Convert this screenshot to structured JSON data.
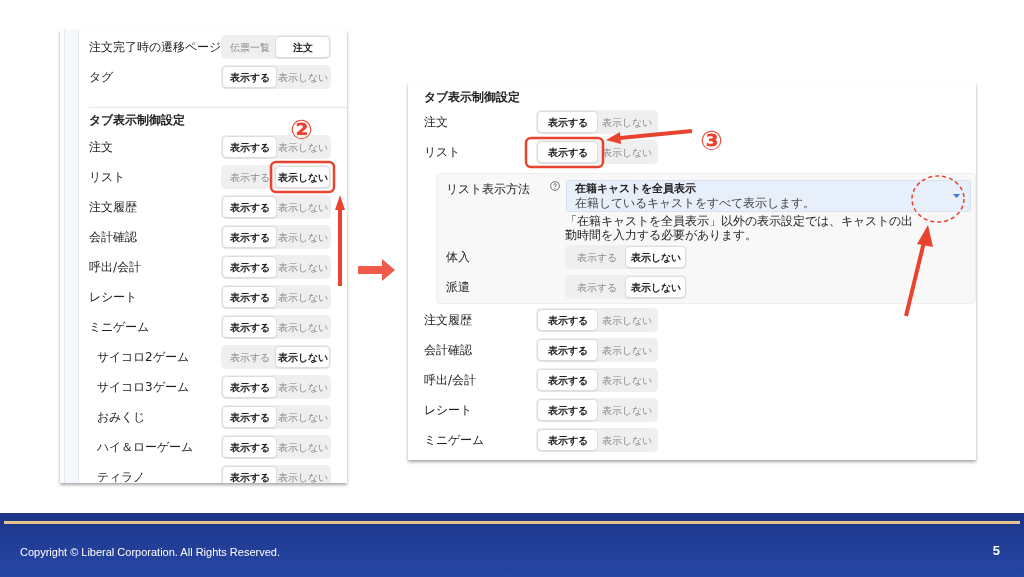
{
  "left_panel": {
    "rows": [
      {
        "kind": "toggle",
        "label": "注文完了時の遷移ページ",
        "options": [
          {
            "label": "伝票一覧",
            "selected": false
          },
          {
            "label": "注文",
            "selected": true
          }
        ]
      },
      {
        "kind": "toggle",
        "label": "タグ",
        "options": [
          {
            "label": "表示する",
            "selected": true
          },
          {
            "label": "表示しない",
            "selected": false
          }
        ]
      },
      {
        "kind": "divider"
      },
      {
        "kind": "heading",
        "label": "タブ表示制御設定"
      },
      {
        "kind": "toggle",
        "label": "注文",
        "options": [
          {
            "label": "表示する",
            "selected": true
          },
          {
            "label": "表示しない",
            "selected": false
          }
        ]
      },
      {
        "kind": "toggle",
        "label": "リスト",
        "options": [
          {
            "label": "表示する",
            "selected": false
          },
          {
            "label": "表示しない",
            "selected": true
          }
        ]
      },
      {
        "kind": "toggle",
        "label": "注文履歴",
        "options": [
          {
            "label": "表示する",
            "selected": true
          },
          {
            "label": "表示しない",
            "selected": false
          }
        ]
      },
      {
        "kind": "toggle",
        "label": "会計確認",
        "options": [
          {
            "label": "表示する",
            "selected": true
          },
          {
            "label": "表示しない",
            "selected": false
          }
        ]
      },
      {
        "kind": "toggle",
        "label": "呼出/会計",
        "options": [
          {
            "label": "表示する",
            "selected": true
          },
          {
            "label": "表示しない",
            "selected": false
          }
        ]
      },
      {
        "kind": "toggle",
        "label": "レシート",
        "options": [
          {
            "label": "表示する",
            "selected": true
          },
          {
            "label": "表示しない",
            "selected": false
          }
        ]
      },
      {
        "kind": "toggle",
        "label": "ミニゲーム",
        "options": [
          {
            "label": "表示する",
            "selected": true
          },
          {
            "label": "表示しない",
            "selected": false
          }
        ],
        "children": [
          {
            "kind": "toggle",
            "label": "サイコロ2ゲーム",
            "options": [
              {
                "label": "表示する",
                "selected": false
              },
              {
                "label": "表示しない",
                "selected": true
              }
            ]
          },
          {
            "kind": "toggle",
            "label": "サイコロ3ゲーム",
            "options": [
              {
                "label": "表示する",
                "selected": true
              },
              {
                "label": "表示しない",
                "selected": false
              }
            ]
          },
          {
            "kind": "toggle",
            "label": "おみくじ",
            "options": [
              {
                "label": "表示する",
                "selected": true
              },
              {
                "label": "表示しない",
                "selected": false
              }
            ]
          },
          {
            "kind": "toggle",
            "label": "ハイ＆ローゲーム",
            "options": [
              {
                "label": "表示する",
                "selected": true
              },
              {
                "label": "表示しない",
                "selected": false
              }
            ]
          },
          {
            "kind": "toggle",
            "label": "ティラノ",
            "options": [
              {
                "label": "表示する",
                "selected": true
              },
              {
                "label": "表示しない",
                "selected": false
              }
            ]
          }
        ]
      }
    ]
  },
  "right_panel": {
    "rows": [
      {
        "kind": "heading",
        "label": "タブ表示制御設定"
      },
      {
        "kind": "toggle",
        "label": "注文",
        "options": [
          {
            "label": "表示する",
            "selected": true
          },
          {
            "label": "表示しない",
            "selected": false
          }
        ]
      },
      {
        "kind": "toggle",
        "label": "リスト",
        "options": [
          {
            "label": "表示する",
            "selected": true
          },
          {
            "label": "表示しない",
            "selected": false
          }
        ]
      },
      {
        "kind": "subpanel",
        "select": {
          "label": "リスト表示方法",
          "value": "在籍キャストを全員表示",
          "description": "在籍しているキャストをすべて表示します。",
          "note": "「在籍キャストを全員表示」以外の表示設定では、キャストの出勤時間を入力する必要があります。"
        },
        "rows": [
          {
            "kind": "toggle",
            "label": "体入",
            "options": [
              {
                "label": "表示する",
                "selected": false
              },
              {
                "label": "表示しない",
                "selected": true
              }
            ]
          },
          {
            "kind": "toggle",
            "label": "派遣",
            "options": [
              {
                "label": "表示する",
                "selected": false
              },
              {
                "label": "表示しない",
                "selected": true
              }
            ]
          }
        ]
      },
      {
        "kind": "toggle",
        "label": "注文履歴",
        "options": [
          {
            "label": "表示する",
            "selected": true
          },
          {
            "label": "表示しない",
            "selected": false
          }
        ]
      },
      {
        "kind": "toggle",
        "label": "会計確認",
        "options": [
          {
            "label": "表示する",
            "selected": true
          },
          {
            "label": "表示しない",
            "selected": false
          }
        ]
      },
      {
        "kind": "toggle",
        "label": "呼出/会計",
        "options": [
          {
            "label": "表示する",
            "selected": true
          },
          {
            "label": "表示しない",
            "selected": false
          }
        ]
      },
      {
        "kind": "toggle",
        "label": "レシート",
        "options": [
          {
            "label": "表示する",
            "selected": true
          },
          {
            "label": "表示しない",
            "selected": false
          }
        ]
      },
      {
        "kind": "toggle",
        "label": "ミニゲーム",
        "options": [
          {
            "label": "表示する",
            "selected": true
          },
          {
            "label": "表示しない",
            "selected": false
          }
        ]
      }
    ]
  },
  "annotations": [
    {
      "kind": "step",
      "text": "②"
    },
    {
      "kind": "step",
      "text": "③"
    }
  ],
  "footer": {
    "copyright": "Copyright ©  Liberal Corporation. All Rights Reserved.",
    "page_number": "5"
  }
}
